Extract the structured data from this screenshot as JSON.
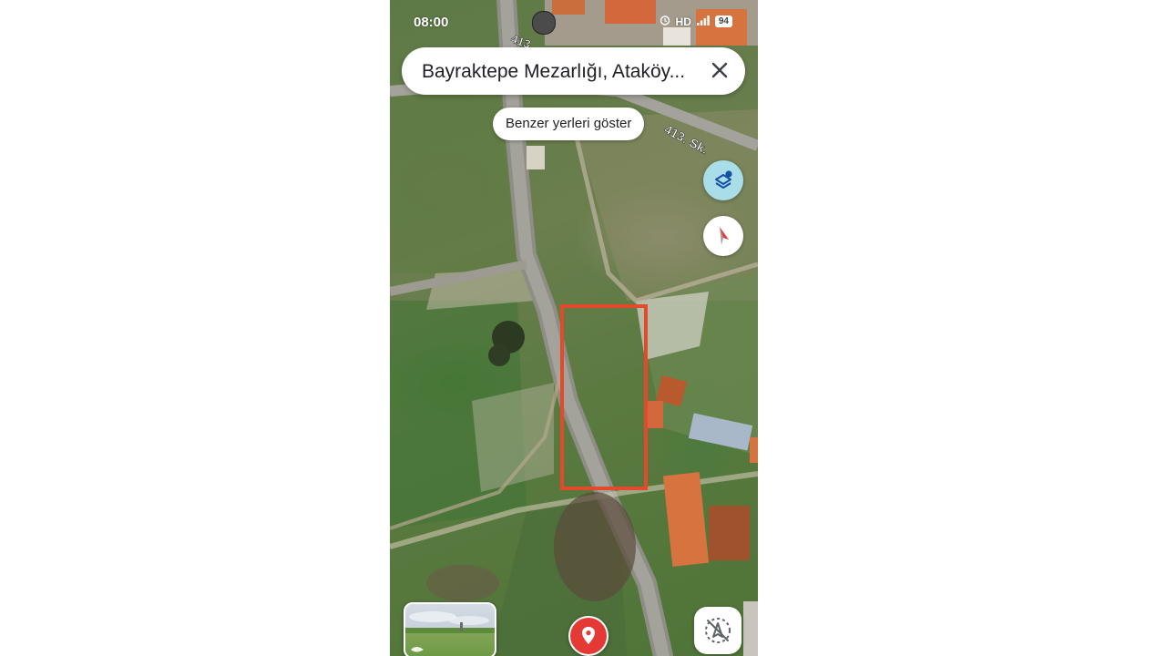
{
  "status_bar": {
    "time": "08:00",
    "network": "HD",
    "battery": "94",
    "icons": [
      "alarm-icon",
      "signal-icon",
      "battery-icon"
    ]
  },
  "search": {
    "query": "Bayraktepe Mezarlığı, Ataköy...",
    "close_icon": "close-icon"
  },
  "chip": {
    "label": "Benzer yerleri göster"
  },
  "map": {
    "type": "satellite",
    "road_label": "413. Sk.",
    "road_label_top": "413",
    "highlight_color": "#e24a2a"
  },
  "controls": {
    "layers_icon": "layers-icon",
    "compass_icon": "compass-icon",
    "recenter_icon": "recenter-icon",
    "pin_icon": "location-pin-icon",
    "street_view_icon": "street-view-thumbnail"
  },
  "colors": {
    "accent_layers": "#a9dde8",
    "pin_red": "#e53935"
  }
}
